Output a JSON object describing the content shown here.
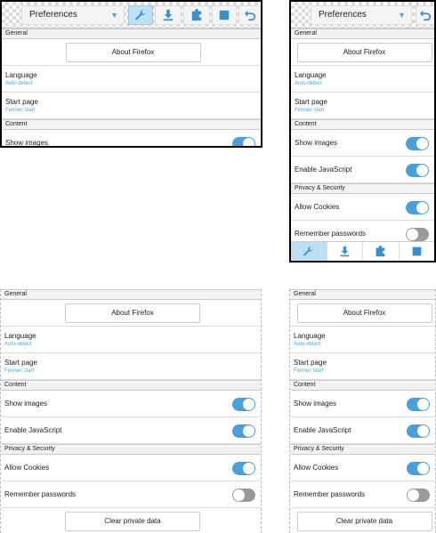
{
  "toolbar": {
    "dropdown_value": "Preferences"
  },
  "sections": {
    "general": "General",
    "content": "Content",
    "privacy": "Privacy & Security"
  },
  "about_button": "About Firefox",
  "language": {
    "label": "Language",
    "value": "Auto-detect"
  },
  "start_page": {
    "label": "Start page",
    "value": "Fennec start"
  },
  "show_images": {
    "label": "Show images",
    "enabled": true
  },
  "enable_js": {
    "label": "Enable JavaScript",
    "enabled": true
  },
  "allow_cookies": {
    "label": "Allow Cookies",
    "enabled": true
  },
  "remember_passwords": {
    "label": "Remember passwords",
    "enabled": false
  },
  "clear_data_button": "Clear private data",
  "icons": [
    "wrench-icon",
    "download-icon",
    "puzzle-icon",
    "stop-icon",
    "undo-icon",
    "chevron-down-icon"
  ],
  "colors": {
    "accent": "#4a9fd8",
    "toggle_off": "#9a9a9a",
    "active_tab": "#bfe0f4"
  }
}
